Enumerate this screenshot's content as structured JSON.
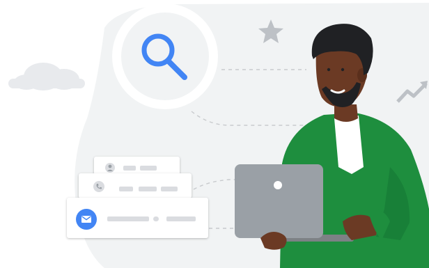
{
  "colors": {
    "background": "#ffffff",
    "blob": "#f1f3f4",
    "search_blue": "#4285f4",
    "shirt_green": "#1e8e3e",
    "laptop_gray": "#9aa0a6",
    "skin": "#6b3a24",
    "hair": "#202124",
    "placeholder_bar": "#dadce0"
  },
  "icons": {
    "search": "search-icon",
    "star": "star-icon",
    "trend": "trend-up-icon",
    "cloud": "cloud-icon",
    "person": "person-icon",
    "phone": "phone-icon",
    "mail": "mail-icon"
  },
  "contact_cards": [
    {
      "icon": "person-icon"
    },
    {
      "icon": "phone-icon"
    },
    {
      "icon": "mail-icon"
    }
  ]
}
